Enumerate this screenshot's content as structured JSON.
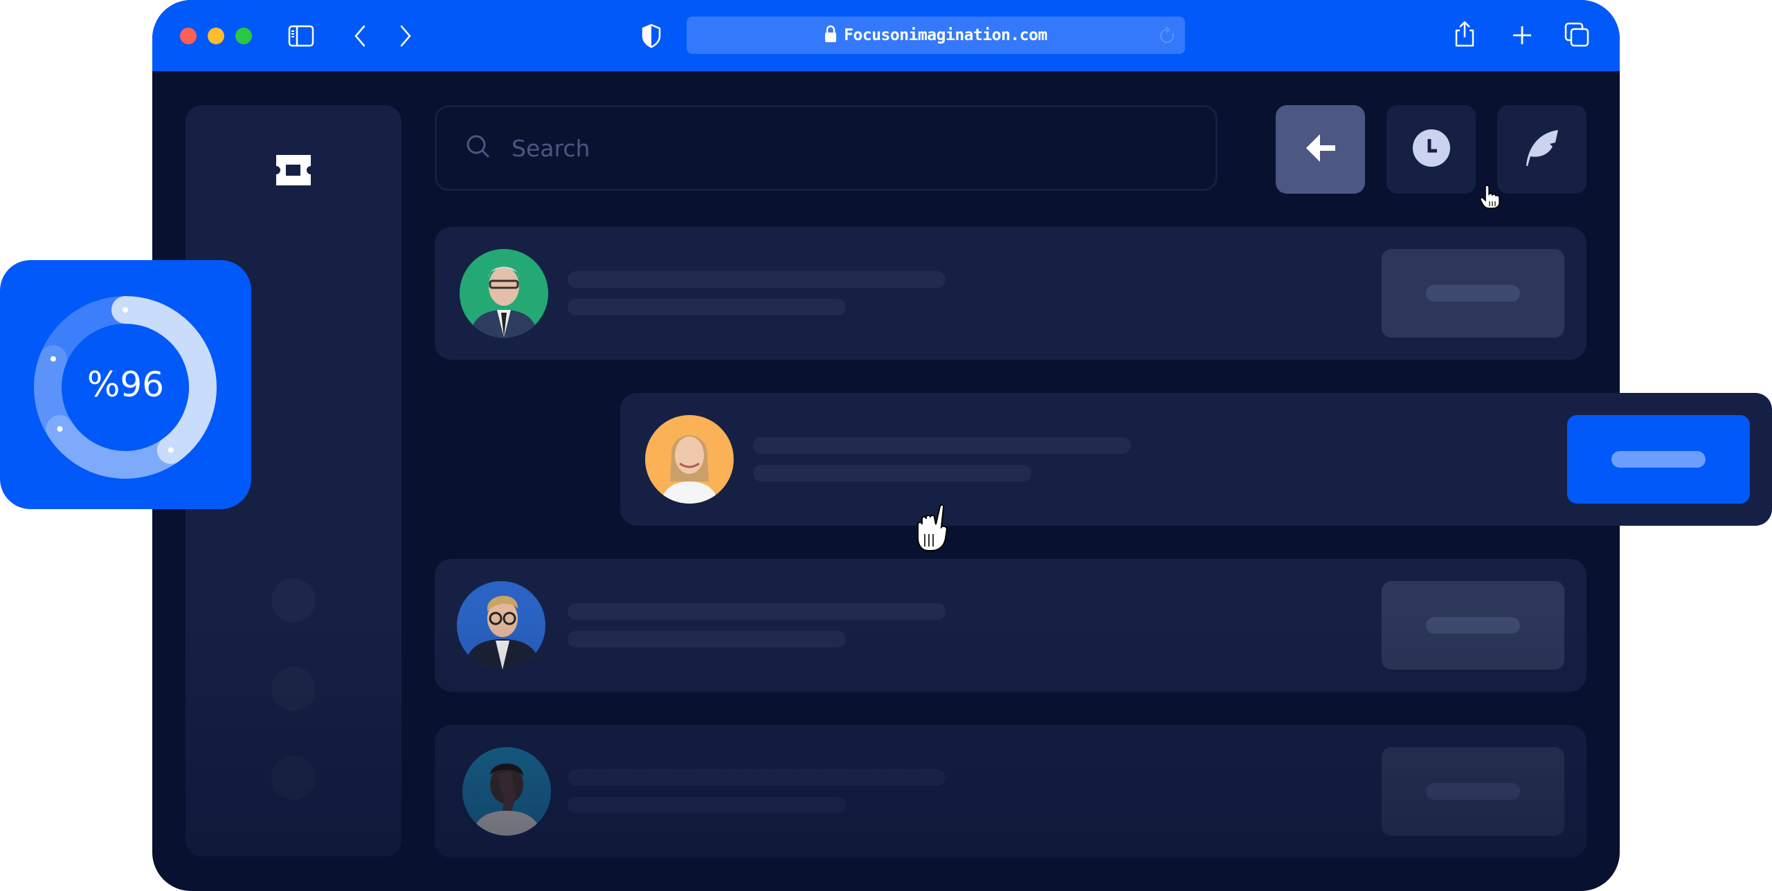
{
  "browser": {
    "url": "Focusonimagination.com",
    "traffic_lights": [
      "close",
      "minimize",
      "maximize"
    ],
    "icons": {
      "sidebar": "sidebar-toggle-icon",
      "back": "chevron-left-icon",
      "forward": "chevron-right-icon",
      "shield": "shield-icon",
      "lock": "lock-icon",
      "reload": "reload-icon",
      "share": "share-icon",
      "new_tab": "plus-icon",
      "tabs": "tabs-overview-icon"
    }
  },
  "app": {
    "logo_icon": "ticket-icon",
    "search": {
      "placeholder": "Search",
      "value": ""
    },
    "toolbar": [
      {
        "name": "back",
        "icon": "arrow-left-icon",
        "active": true
      },
      {
        "name": "history",
        "icon": "clock-icon",
        "active": false
      },
      {
        "name": "compose",
        "icon": "feather-icon",
        "active": false
      }
    ],
    "sidebar_items": 3,
    "list": [
      {
        "avatar": "older man with glasses, green background",
        "avatar_bg": "#24a874",
        "highlighted": false
      },
      {
        "avatar": "smiling blonde woman, orange background",
        "avatar_bg": "#fbb155",
        "highlighted": true
      },
      {
        "avatar": "young man with glasses, blue background",
        "avatar_bg": "#2a63c3",
        "highlighted": false
      },
      {
        "avatar": "man covering face, teal background",
        "avatar_bg": "#1a6f99",
        "highlighted": false
      }
    ]
  },
  "widget": {
    "label": "%96",
    "value_percent": 96,
    "segments": [
      {
        "from_pct": 0,
        "to_pct": 40,
        "color": "#c9dcfc"
      },
      {
        "from_pct": 40,
        "to_pct": 66,
        "color": "#7eaafc"
      },
      {
        "from_pct": 66,
        "to_pct": 81,
        "color": "#5c93fb"
      },
      {
        "from_pct": 81,
        "to_pct": 100,
        "color": "#3d7ffa"
      }
    ]
  },
  "colors": {
    "brand_blue": "#0059f8",
    "app_bg": "#08112f",
    "panel": "#162044",
    "active_button": "#4c5883"
  }
}
